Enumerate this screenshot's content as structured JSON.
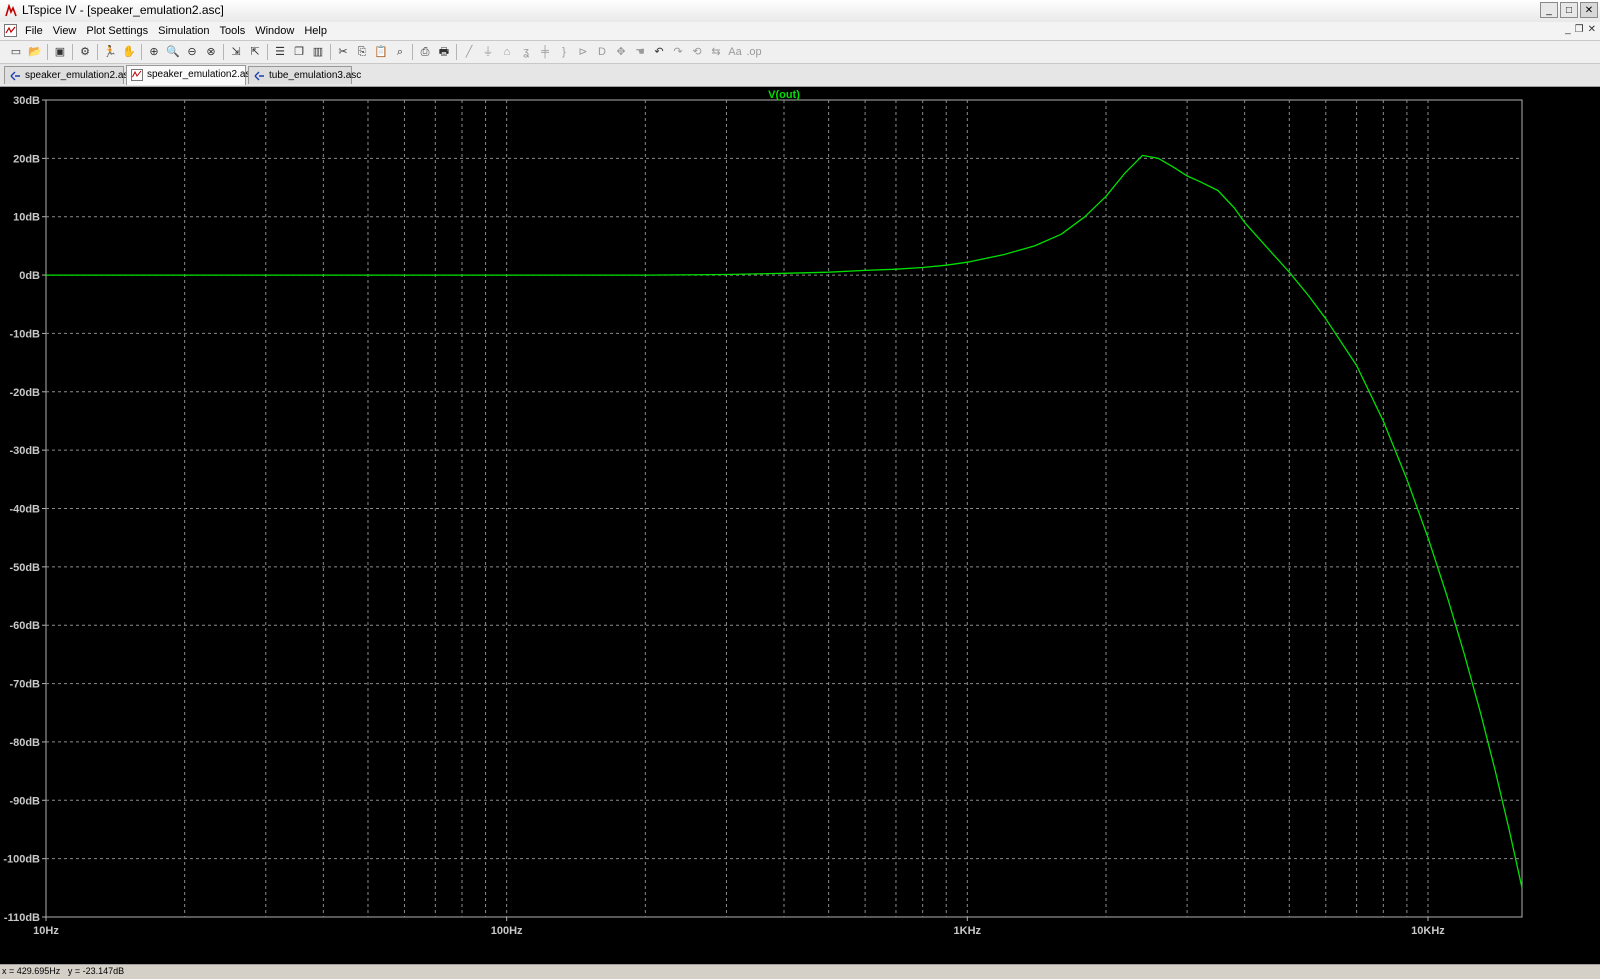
{
  "window": {
    "title": "LTspice IV - [speaker_emulation2.asc]"
  },
  "menu": [
    "File",
    "View",
    "Plot Settings",
    "Simulation",
    "Tools",
    "Window",
    "Help"
  ],
  "toolbar": [
    {
      "name": "new-schematic-icon",
      "glyph": "▭"
    },
    {
      "name": "open-icon",
      "glyph": "📂"
    },
    {
      "sep": true
    },
    {
      "name": "save-icon",
      "glyph": "▣"
    },
    {
      "sep": true
    },
    {
      "name": "control-panel-icon",
      "glyph": "⚙"
    },
    {
      "sep": true
    },
    {
      "name": "run-icon",
      "glyph": "🏃"
    },
    {
      "name": "pan-icon",
      "glyph": "✋"
    },
    {
      "sep": true
    },
    {
      "name": "zoom-in-icon",
      "glyph": "⊕"
    },
    {
      "name": "zoom-area-icon",
      "glyph": "🔍"
    },
    {
      "name": "zoom-out-icon",
      "glyph": "⊖"
    },
    {
      "name": "zoom-full-icon",
      "glyph": "⊗"
    },
    {
      "sep": true
    },
    {
      "name": "autorange-icon",
      "glyph": "⇲"
    },
    {
      "name": "add-trace-icon",
      "glyph": "⇱"
    },
    {
      "sep": true
    },
    {
      "name": "tile-horizontal-icon",
      "glyph": "☰"
    },
    {
      "name": "cascade-icon",
      "glyph": "❐"
    },
    {
      "name": "tile-vertical-icon",
      "glyph": "▥"
    },
    {
      "sep": true
    },
    {
      "name": "cut-icon",
      "glyph": "✂"
    },
    {
      "name": "copy-icon",
      "glyph": "⎘"
    },
    {
      "name": "paste-icon",
      "glyph": "📋"
    },
    {
      "name": "find-icon",
      "glyph": "⌕"
    },
    {
      "sep": true
    },
    {
      "name": "print-preview-icon",
      "glyph": "⎙"
    },
    {
      "name": "print-icon",
      "glyph": "🖶"
    },
    {
      "sep": true
    },
    {
      "name": "wire-icon",
      "glyph": "╱",
      "dim": true
    },
    {
      "name": "ground-icon",
      "glyph": "⏚",
      "dim": true
    },
    {
      "name": "label-net-icon",
      "glyph": "⌂",
      "dim": true
    },
    {
      "name": "resistor-icon",
      "glyph": "ʓ",
      "dim": true
    },
    {
      "name": "capacitor-icon",
      "glyph": "╪",
      "dim": true
    },
    {
      "name": "inductor-icon",
      "glyph": "}",
      "dim": true
    },
    {
      "name": "diode-icon",
      "glyph": "⊳",
      "dim": true
    },
    {
      "name": "component-icon",
      "glyph": "D",
      "dim": true
    },
    {
      "name": "move-icon",
      "glyph": "✥",
      "dim": true
    },
    {
      "name": "drag-icon",
      "glyph": "☚",
      "dim": true
    },
    {
      "name": "undo-icon",
      "glyph": "↶"
    },
    {
      "name": "redo-icon",
      "glyph": "↷",
      "dim": true
    },
    {
      "name": "rotate-icon",
      "glyph": "⟲",
      "dim": true
    },
    {
      "name": "mirror-icon",
      "glyph": "⇆",
      "dim": true
    },
    {
      "name": "text-icon",
      "glyph": "Aa",
      "dim": true
    },
    {
      "name": "spice-directive-icon",
      "glyph": ".op",
      "dim": true
    }
  ],
  "tabs": [
    {
      "label": "speaker_emulation2.asc",
      "kind": "schematic",
      "active": false
    },
    {
      "label": "speaker_emulation2.asc",
      "kind": "waveform",
      "active": true
    },
    {
      "label": "tube_emulation3.asc",
      "kind": "schematic",
      "active": false
    }
  ],
  "status": {
    "x": "x = 429.695Hz",
    "y": "y = -23.147dB"
  },
  "chart_data": {
    "type": "line",
    "title": "V(out)",
    "xscale": "log",
    "xlim": [
      10,
      16000
    ],
    "ylim": [
      -110,
      30
    ],
    "xticks": [
      10,
      100,
      1000,
      10000
    ],
    "xtick_labels": [
      "10Hz",
      "100Hz",
      "1KHz",
      "10KHz"
    ],
    "yticks": [
      30,
      20,
      10,
      0,
      -10,
      -20,
      -30,
      -40,
      -50,
      -60,
      -70,
      -80,
      -90,
      -100,
      -110
    ],
    "ytick_labels": [
      "30dB",
      "20dB",
      "10dB",
      "0dB",
      "-10dB",
      "-20dB",
      "-30dB",
      "-40dB",
      "-50dB",
      "-60dB",
      "-70dB",
      "-80dB",
      "-90dB",
      "-100dB",
      "-110dB"
    ],
    "grid": true,
    "background": "#000000",
    "grid_color": "#8c8c8c",
    "trace_color": "#00e000",
    "series": [
      {
        "name": "V(out)",
        "x": [
          10,
          50,
          100,
          200,
          300,
          400,
          500,
          600,
          700,
          800,
          900,
          1000,
          1200,
          1400,
          1600,
          1800,
          2000,
          2200,
          2400,
          2600,
          2800,
          3000,
          3200,
          3500,
          3800,
          4000,
          4500,
          5000,
          5500,
          6000,
          7000,
          8000,
          9000,
          10000,
          11000,
          12000,
          13000,
          14000,
          15000,
          16000
        ],
        "y": [
          0,
          0,
          0,
          0,
          0.1,
          0.3,
          0.5,
          0.8,
          1.0,
          1.3,
          1.7,
          2.2,
          3.5,
          5.0,
          7.0,
          10.0,
          13.5,
          17.5,
          20.5,
          20.0,
          18.5,
          17.0,
          16.0,
          14.5,
          11.5,
          9.0,
          4.5,
          0.5,
          -3.5,
          -7.5,
          -15.5,
          -25,
          -35,
          -45,
          -55,
          -65,
          -75,
          -85,
          -95,
          -105
        ]
      }
    ]
  }
}
